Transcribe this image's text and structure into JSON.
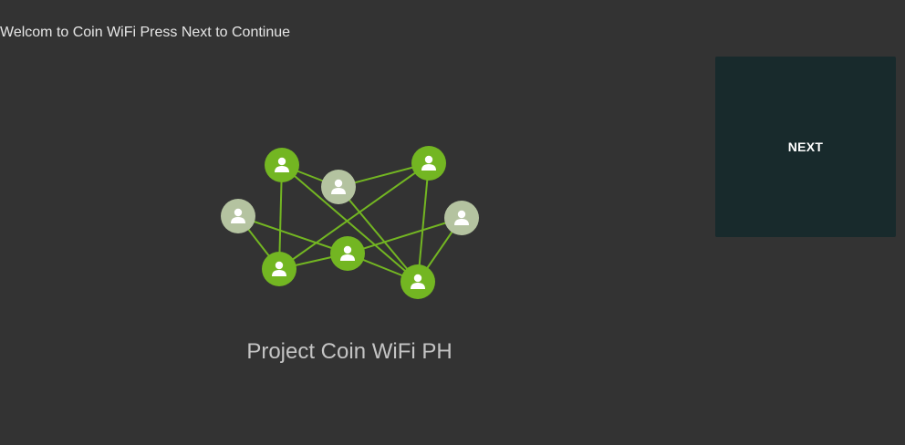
{
  "header": {
    "welcome_text": "Welcom to Coin WiFi Press Next to Continue"
  },
  "actions": {
    "next_label": "NEXT"
  },
  "brand": {
    "name": "Project Coin WiFi PH",
    "illustration_icon": "user-network-icon"
  },
  "colors": {
    "background": "#333333",
    "button_bg": "#182a2c",
    "node_active": "#73b622",
    "node_inactive": "#b4c3a0",
    "link": "#73b622",
    "brand_text": "#c4c4c4"
  }
}
